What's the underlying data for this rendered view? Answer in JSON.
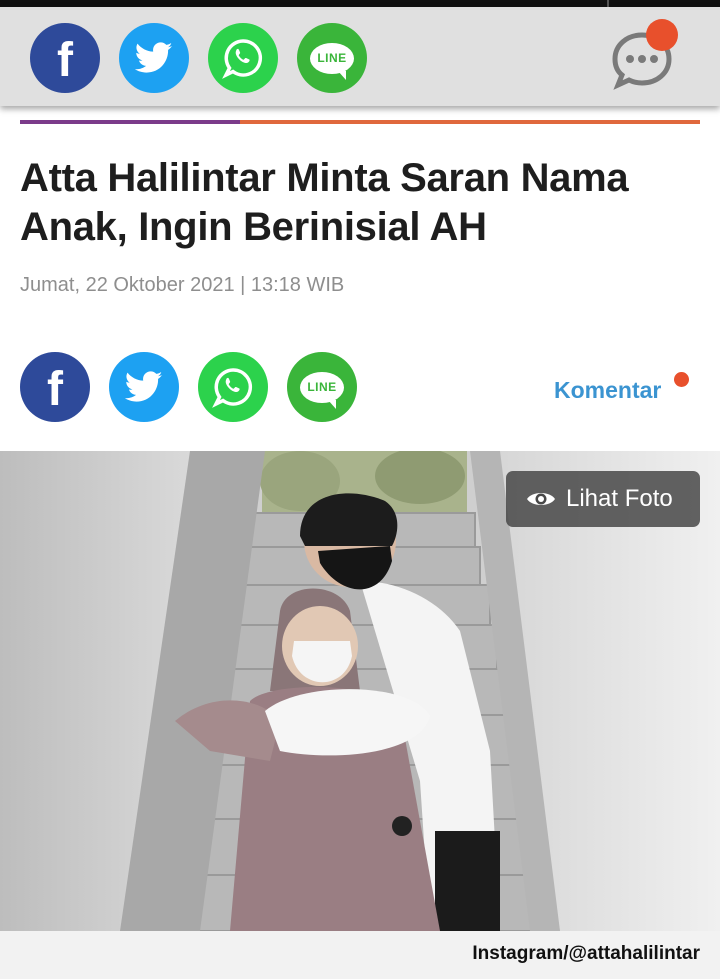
{
  "share_bar": {
    "icons": [
      {
        "name": "facebook-icon",
        "color": "#2e4a9a",
        "glyph": "f"
      },
      {
        "name": "twitter-icon",
        "color": "#1da1f2"
      },
      {
        "name": "whatsapp-icon",
        "color": "#2cd24c"
      },
      {
        "name": "line-icon",
        "color": "#3ab53a",
        "glyph": "LINE"
      }
    ],
    "comment_icon": "chat-bubble-icon",
    "badge_color": "#e8502c"
  },
  "article": {
    "title": "Atta Halilintar Minta Saran Nama Anak, Ingin Berinisial AH",
    "date": "Jumat, 22 Oktober 2021 | 13:18 WIB",
    "share_icons": [
      {
        "name": "facebook-icon",
        "glyph": "f"
      },
      {
        "name": "twitter-icon"
      },
      {
        "name": "whatsapp-icon"
      },
      {
        "name": "line-icon",
        "glyph": "LINE"
      }
    ],
    "komentar_label": "Komentar"
  },
  "photo": {
    "lihat_foto_label": "Lihat Foto",
    "caption": "Instagram/@attahalilintar"
  },
  "colors": {
    "accent_purple": "#7b3b8a",
    "accent_orange": "#e0683d",
    "link_blue": "#3b94d1",
    "title": "#1e1e1e",
    "date_gray": "#8e8e8e"
  }
}
